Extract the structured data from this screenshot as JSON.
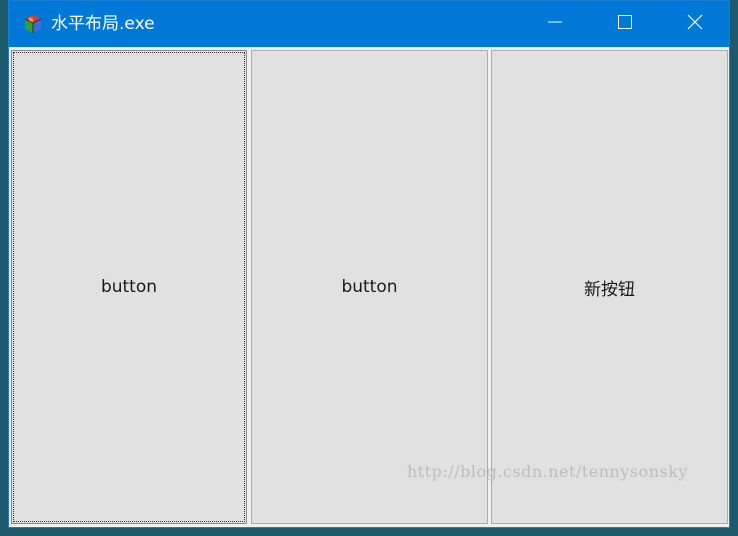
{
  "window": {
    "title": "水平布局.exe",
    "accent_color": "#0078d7",
    "icon": "app-cube-icon"
  },
  "controls": {
    "minimize_icon": "minimize-icon",
    "maximize_icon": "maximize-icon",
    "close_icon": "close-icon"
  },
  "buttons": [
    {
      "label": "button",
      "focused": true
    },
    {
      "label": "button",
      "focused": false
    },
    {
      "label": "新按钮",
      "focused": false
    }
  ],
  "watermark": "http://blog.csdn.net/tennysonsky"
}
